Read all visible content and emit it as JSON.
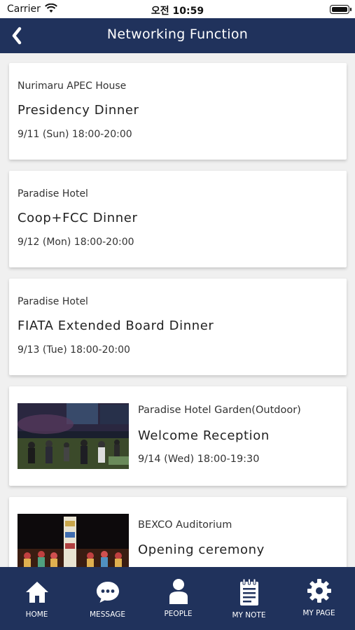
{
  "status": {
    "carrier": "Carrier",
    "time": "오전 10:59"
  },
  "header": {
    "title": "Networking Function"
  },
  "events": [
    {
      "venue": "Nurimaru APEC House",
      "name": "Presidency Dinner",
      "when": "9/11 (Sun) 18:00-20:00"
    },
    {
      "venue": "Paradise Hotel",
      "name": "Coop+FCC Dinner",
      "when": "9/12 (Mon) 18:00-20:00"
    },
    {
      "venue": "Paradise Hotel",
      "name": "FIATA Extended Board Dinner",
      "when": "9/13 (Tue) 18:00-20:00"
    },
    {
      "venue": "Paradise Hotel Garden(Outdoor)",
      "name": "Welcome Reception",
      "when": "9/14 (Wed) 18:00-19:30"
    },
    {
      "venue": "BEXCO Auditorium",
      "name": "Opening ceremony"
    }
  ],
  "tabs": {
    "home": "HOME",
    "message": "MESSAGE",
    "people": "PEOPLE",
    "note": "MY NOTE",
    "mypage": "MY PAGE"
  },
  "colors": {
    "navy": "#20325c",
    "background": "#f0f0f0",
    "card": "#ffffff"
  },
  "icons": [
    "wifi-icon",
    "battery-icon",
    "back-chevron-icon",
    "home-icon",
    "chat-bubble-icon",
    "person-icon",
    "notepad-icon",
    "gear-icon"
  ]
}
